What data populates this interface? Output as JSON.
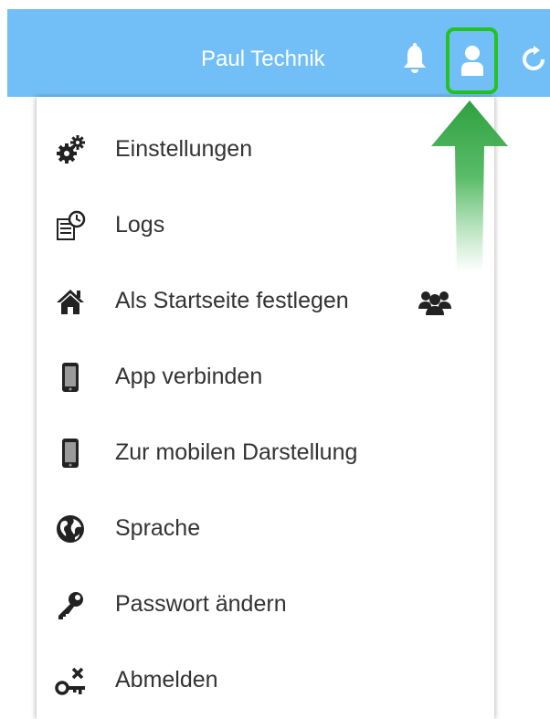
{
  "header": {
    "user_name": "Paul Technik",
    "accent_color": "#72bff7",
    "highlight_color": "#24c31f"
  },
  "icons": {
    "bell": "bell-icon",
    "user": "user-icon",
    "refresh": "refresh-icon"
  },
  "menu": {
    "items": [
      {
        "label": "Einstellungen",
        "icon": "gears-icon"
      },
      {
        "label": "Logs",
        "icon": "logs-icon"
      },
      {
        "label": "Als Startseite festlegen",
        "icon": "home-icon",
        "extra_icon": "group-icon"
      },
      {
        "label": "App verbinden",
        "icon": "mobile-phone-icon"
      },
      {
        "label": "Zur mobilen Darstellung",
        "icon": "mobile-phone-icon"
      },
      {
        "label": "Sprache",
        "icon": "globe-icon"
      },
      {
        "label": "Passwort ändern",
        "icon": "key-icon"
      },
      {
        "label": "Abmelden",
        "icon": "logout-key-icon"
      }
    ]
  }
}
